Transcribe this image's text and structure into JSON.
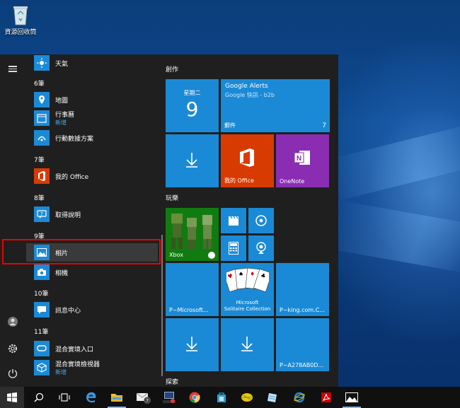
{
  "desktop": {
    "recycle_bin_label": "資源回收筒"
  },
  "start": {
    "rail": {
      "menu_icon": "hamburger-icon",
      "user_icon": "user-icon",
      "settings_icon": "gear-icon",
      "power_icon": "power-icon"
    },
    "applist": {
      "items": [
        {
          "type": "app",
          "name": "天氣",
          "icon": "sun-icon"
        },
        {
          "type": "group",
          "name": "6筆"
        },
        {
          "type": "app",
          "name": "地圖",
          "icon": "map-icon"
        },
        {
          "type": "app",
          "name": "行事曆",
          "sub": "新增",
          "icon": "calendar-icon"
        },
        {
          "type": "app",
          "name": "行動數據方案",
          "icon": "data-plan-icon"
        },
        {
          "type": "group",
          "name": "7筆"
        },
        {
          "type": "app",
          "name": "我的 Office",
          "icon": "office-icon"
        },
        {
          "type": "group",
          "name": "8筆"
        },
        {
          "type": "app",
          "name": "取得說明",
          "icon": "help-icon"
        },
        {
          "type": "group",
          "name": "9筆"
        },
        {
          "type": "app",
          "name": "相片",
          "icon": "photos-icon"
        },
        {
          "type": "app",
          "name": "相機",
          "icon": "camera-icon"
        },
        {
          "type": "group",
          "name": "10筆"
        },
        {
          "type": "app",
          "name": "訊息中心",
          "icon": "message-icon"
        },
        {
          "type": "group",
          "name": "11筆"
        },
        {
          "type": "app",
          "name": "混合實境入口",
          "icon": "mixed-reality-icon"
        },
        {
          "type": "app",
          "name": "混合實境檢視器",
          "sub": "新增",
          "icon": "cube-icon"
        }
      ]
    },
    "tiles": {
      "sections": {
        "create": "創作",
        "play": "玩樂",
        "explore": "探索"
      },
      "calendar": {
        "weekday": "星期二",
        "day": "9"
      },
      "mail": {
        "title": "Google Alerts",
        "subtitle": "Google 快訊 - b2b",
        "label": "郵件",
        "count": "7"
      },
      "download1": {
        "icon": "download-icon"
      },
      "office": {
        "label": "我的 Office"
      },
      "onenote": {
        "label": "OneNote"
      },
      "xbox": {
        "label": "Xbox"
      },
      "solitaire": {
        "label": "P~Microsoft...",
        "caption1": "Microsoft",
        "caption2": "Solitaire Collection"
      },
      "king": {
        "label": "P~king.com.C..."
      },
      "download2": {
        "icon": "download-icon"
      },
      "download3": {
        "icon": "download-icon"
      },
      "p278": {
        "label": "P~A278AB0D..."
      }
    }
  },
  "taskbar": {
    "items": [
      "windows-start-icon",
      "search-icon",
      "task-view-icon",
      "edge-icon",
      "file-explorer-icon",
      "mail-icon",
      "network-icon",
      "chrome-icon",
      "store-icon",
      "winrar-icon",
      "notepad-icon",
      "ie-icon",
      "acrobat-icon",
      "photos-icon"
    ],
    "mail_badge": "7"
  },
  "colors": {
    "tile_blue": "#1b8ad6",
    "office_red": "#d83b01",
    "onenote_purple": "#8a2db3",
    "xbox_green": "#107c10",
    "start_bg": "#1f1f1f",
    "taskbar_bg": "#101010"
  }
}
